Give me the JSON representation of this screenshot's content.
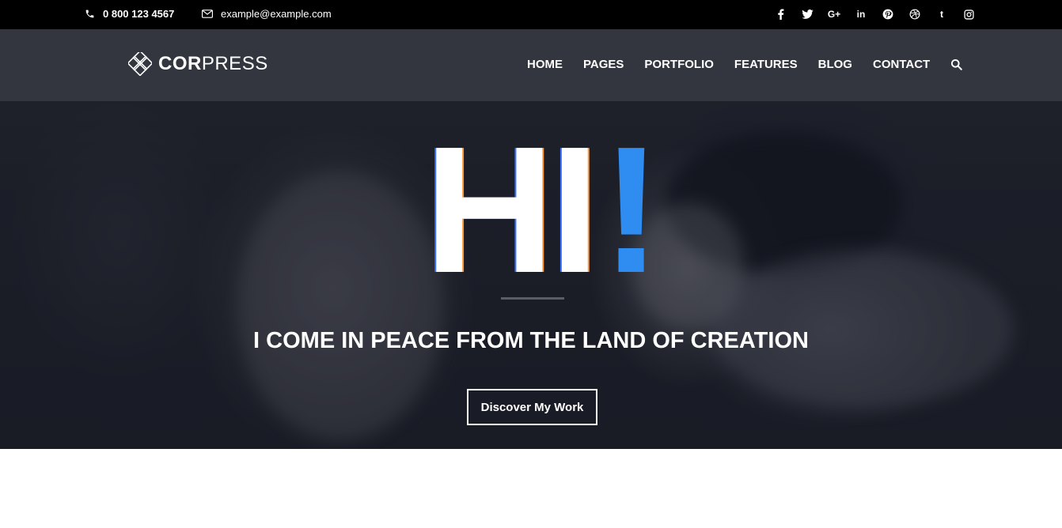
{
  "topbar": {
    "phone": "0 800 123 4567",
    "email": "example@example.com",
    "social_icons": [
      "facebook-icon",
      "twitter-icon",
      "google-plus-icon",
      "linkedin-icon",
      "pinterest-icon",
      "dribbble-icon",
      "tumblr-icon",
      "instagram-icon"
    ]
  },
  "header": {
    "logo_bold": "COR",
    "logo_light": "PRESS",
    "menu": [
      "HOME",
      "PAGES",
      "PORTFOLIO",
      "FEATURES",
      "BLOG",
      "CONTACT"
    ]
  },
  "hero": {
    "headline": "HI",
    "headline_mark": "!",
    "tagline": "I COME IN PEACE FROM THE LAND OF CREATION",
    "cta_label": "Discover My Work",
    "accent_color": "#2f8cf0"
  }
}
